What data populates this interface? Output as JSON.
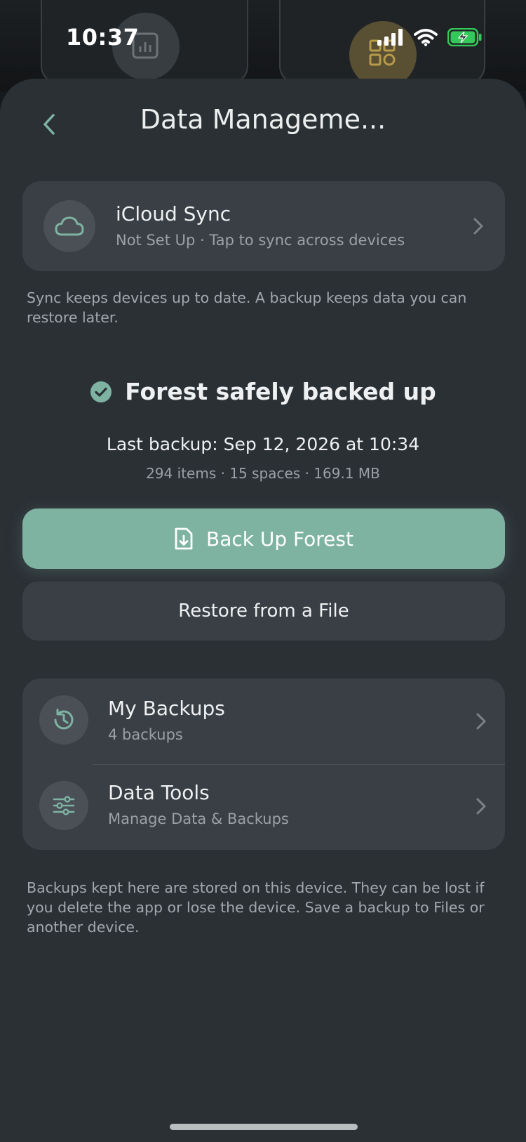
{
  "status_bar": {
    "time": "10:37"
  },
  "header": {
    "title": "Data Manageme..."
  },
  "icloud": {
    "title": "iCloud Sync",
    "subtitle": "Not Set Up · Tap to sync across devices"
  },
  "sync_hint": "Sync keeps devices up to date. A backup keeps data you can restore later.",
  "backup_status": {
    "headline": "Forest safely backed up",
    "last_backup": "Last backup: Sep 12, 2026 at 10:34",
    "meta": "294 items · 15 spaces · 169.1 MB"
  },
  "actions": {
    "primary": "Back Up Forest",
    "secondary": "Restore from a File"
  },
  "list": [
    {
      "title": "My Backups",
      "subtitle": "4 backups"
    },
    {
      "title": "Data Tools",
      "subtitle": "Manage Data & Backups"
    }
  ],
  "footer_note": "Backups kept here are stored on this device. They can be lost if you delete the app or lose the device. Save a backup to Files or another device.",
  "colors": {
    "accent": "#7eb3a2",
    "sheet": "#2b3035",
    "card": "#3a3f45",
    "battery": "#34c759"
  },
  "icons": [
    "back-chevron-icon",
    "cloud-icon",
    "check-circle-icon",
    "document-download-icon",
    "history-icon",
    "sliders-icon",
    "chevron-right-icon"
  ]
}
